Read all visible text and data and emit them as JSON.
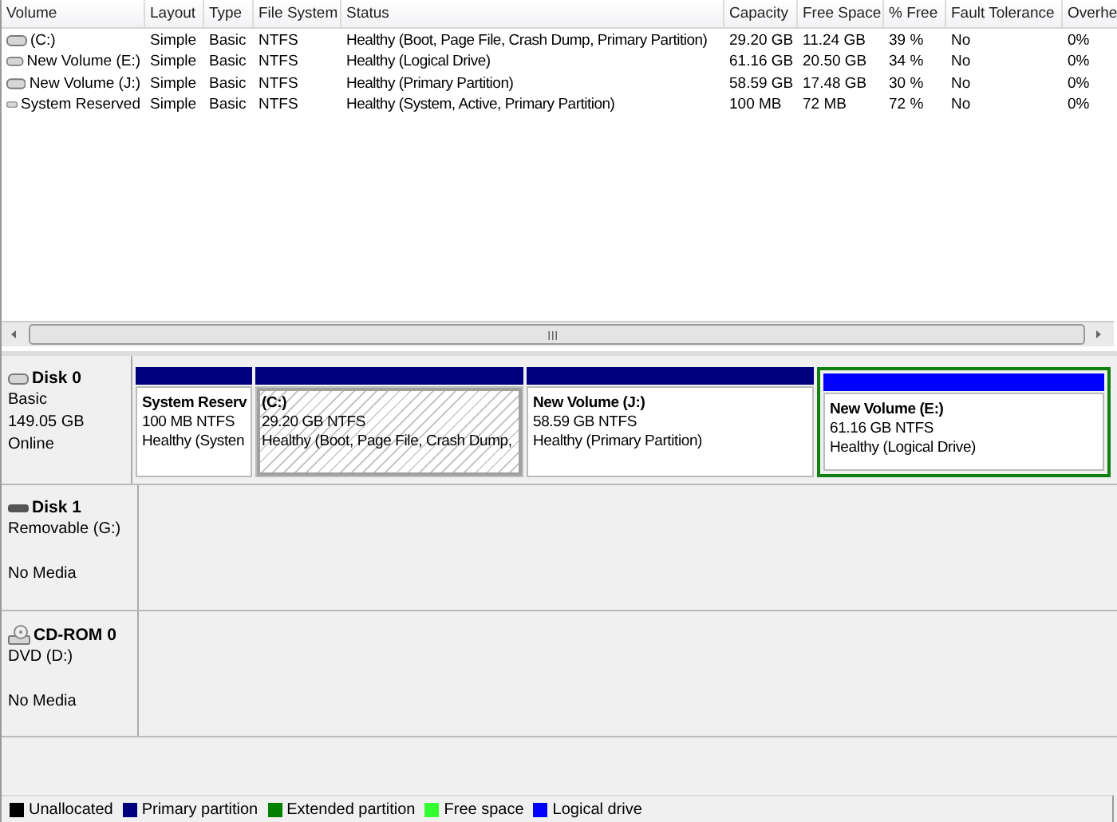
{
  "volume_list": {
    "columns": [
      "Volume",
      "Layout",
      "Type",
      "File System",
      "Status",
      "Capacity",
      "Free Space",
      "% Free",
      "Fault Tolerance",
      "Overhe"
    ],
    "rows": [
      {
        "cells": [
          "(C:)",
          "Simple",
          "Basic",
          "NTFS",
          "Healthy (Boot, Page File, Crash Dump, Primary Partition)",
          "29.20 GB",
          "11.24 GB",
          "39 %",
          "No",
          "0%"
        ]
      },
      {
        "cells": [
          "New Volume (E:)",
          "Simple",
          "Basic",
          "NTFS",
          "Healthy (Logical Drive)",
          "61.16 GB",
          "20.50 GB",
          "34 %",
          "No",
          "0%"
        ]
      },
      {
        "cells": [
          "New Volume (J:)",
          "Simple",
          "Basic",
          "NTFS",
          "Healthy (Primary Partition)",
          "58.59 GB",
          "17.48 GB",
          "30 %",
          "No",
          "0%"
        ]
      },
      {
        "cells": [
          "System Reserved",
          "Simple",
          "Basic",
          "NTFS",
          "Healthy (System, Active, Primary Partition)",
          "100 MB",
          "72 MB",
          "72 %",
          "No",
          "0%"
        ]
      }
    ],
    "scrollbar_grip": "III"
  },
  "disks": [
    {
      "kind": "disk",
      "name": "Disk 0",
      "lines": [
        "Basic",
        "149.05 GB"
      ],
      "status": "Online",
      "partitions": [
        {
          "kind": "primary",
          "name": "System Reserv",
          "size": "100 MB NTFS",
          "status": "Healthy (Systen",
          "selected": false
        },
        {
          "kind": "primary",
          "name": "(C:)",
          "size": "29.20 GB NTFS",
          "status": "Healthy (Boot, Page File, Crash Dump,",
          "selected": true
        },
        {
          "kind": "primary",
          "name": "New Volume  (J:)",
          "size": "58.59 GB NTFS",
          "status": "Healthy (Primary Partition)",
          "selected": false
        },
        {
          "kind": "logical",
          "name": "New Volume  (E:)",
          "size": "61.16 GB NTFS",
          "status": "Healthy (Logical Drive)",
          "selected": false
        }
      ]
    },
    {
      "kind": "removable",
      "name": "Disk 1",
      "lines": [
        "Removable (G:)"
      ],
      "status": "No Media"
    },
    {
      "kind": "cdrom",
      "name": "CD-ROM 0",
      "lines": [
        "DVD (D:)"
      ],
      "status": "No Media"
    }
  ],
  "legend": [
    {
      "label": "Unallocated",
      "color": "#000000"
    },
    {
      "label": "Primary partition",
      "color": "#00007f"
    },
    {
      "label": "Extended partition",
      "color": "#008000"
    },
    {
      "label": "Free space",
      "color": "#33ff33"
    },
    {
      "label": "Logical drive",
      "color": "#0000ff"
    }
  ]
}
